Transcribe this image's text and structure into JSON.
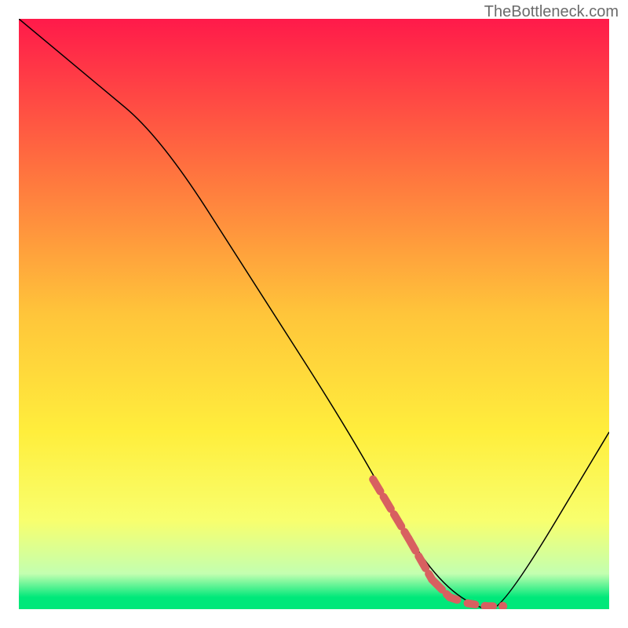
{
  "watermark": "TheBottleneck.com",
  "chart_data": {
    "type": "line",
    "title": "",
    "xlabel": "",
    "ylabel": "",
    "xlim": [
      0,
      100
    ],
    "ylim": [
      0,
      100
    ],
    "series": [
      {
        "name": "curve",
        "x": [
          0,
          12,
          24,
          40,
          56,
          66,
          72,
          78,
          82,
          100
        ],
        "y": [
          100,
          90,
          80,
          55,
          30,
          12,
          4,
          0,
          0,
          30
        ]
      },
      {
        "name": "highlighted-segment",
        "x": [
          60,
          66,
          70,
          73,
          76,
          79,
          82
        ],
        "y": [
          22,
          12,
          5,
          2,
          1,
          0.5,
          0.5
        ]
      }
    ],
    "gradient_stops": [
      {
        "offset": 0,
        "color": "#ff1a4a"
      },
      {
        "offset": 25,
        "color": "#ff703f"
      },
      {
        "offset": 50,
        "color": "#ffc53a"
      },
      {
        "offset": 70,
        "color": "#ffee3c"
      },
      {
        "offset": 85,
        "color": "#f8ff6e"
      },
      {
        "offset": 94,
        "color": "#c3ffb0"
      },
      {
        "offset": 98,
        "color": "#00e87a"
      },
      {
        "offset": 100,
        "color": "#00e87a"
      }
    ]
  }
}
